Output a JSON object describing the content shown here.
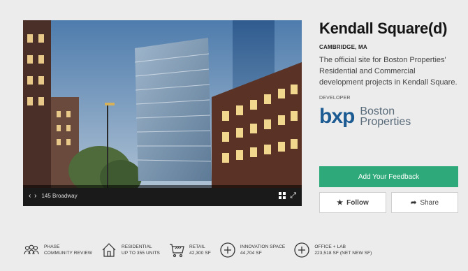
{
  "hero": {
    "caption": "145 Broadway",
    "nav_arrows": "‹ ›",
    "grid_icon": "grid-icon",
    "expand_icon": "expand-icon"
  },
  "project": {
    "title": "Kendall Square(d)",
    "location": "CAMBRIDGE, MA",
    "description": "The official site for Boston Properties' Residential and Commercial development projects in Kendall Square.",
    "developer_label": "DEVELOPER",
    "developer_logo_mark": "bxp",
    "developer_name_line1": "Boston",
    "developer_name_line2": "Properties"
  },
  "actions": {
    "feedback_label": "Add Your Feedback",
    "follow_label": "Follow",
    "share_label": "Share"
  },
  "stats": [
    {
      "icon": "people-icon",
      "label": "PHASE",
      "value": "COMMUNITY REVIEW"
    },
    {
      "icon": "house-icon",
      "label": "RESIDENTIAL",
      "value": "UP TO 355 UNITS"
    },
    {
      "icon": "cart-icon",
      "label": "RETAIL",
      "value": "42,300 SF"
    },
    {
      "icon": "plus-circle-icon",
      "label": "INNOVATION SPACE",
      "value": "44,704 SF"
    },
    {
      "icon": "plus-circle-icon",
      "label": "OFFICE + LAB",
      "value": "223,518 SF (NET NEW SF)"
    }
  ],
  "colors": {
    "accent_green": "#2eaa7a",
    "logo_blue": "#1d5b93",
    "background": "#ececec"
  }
}
